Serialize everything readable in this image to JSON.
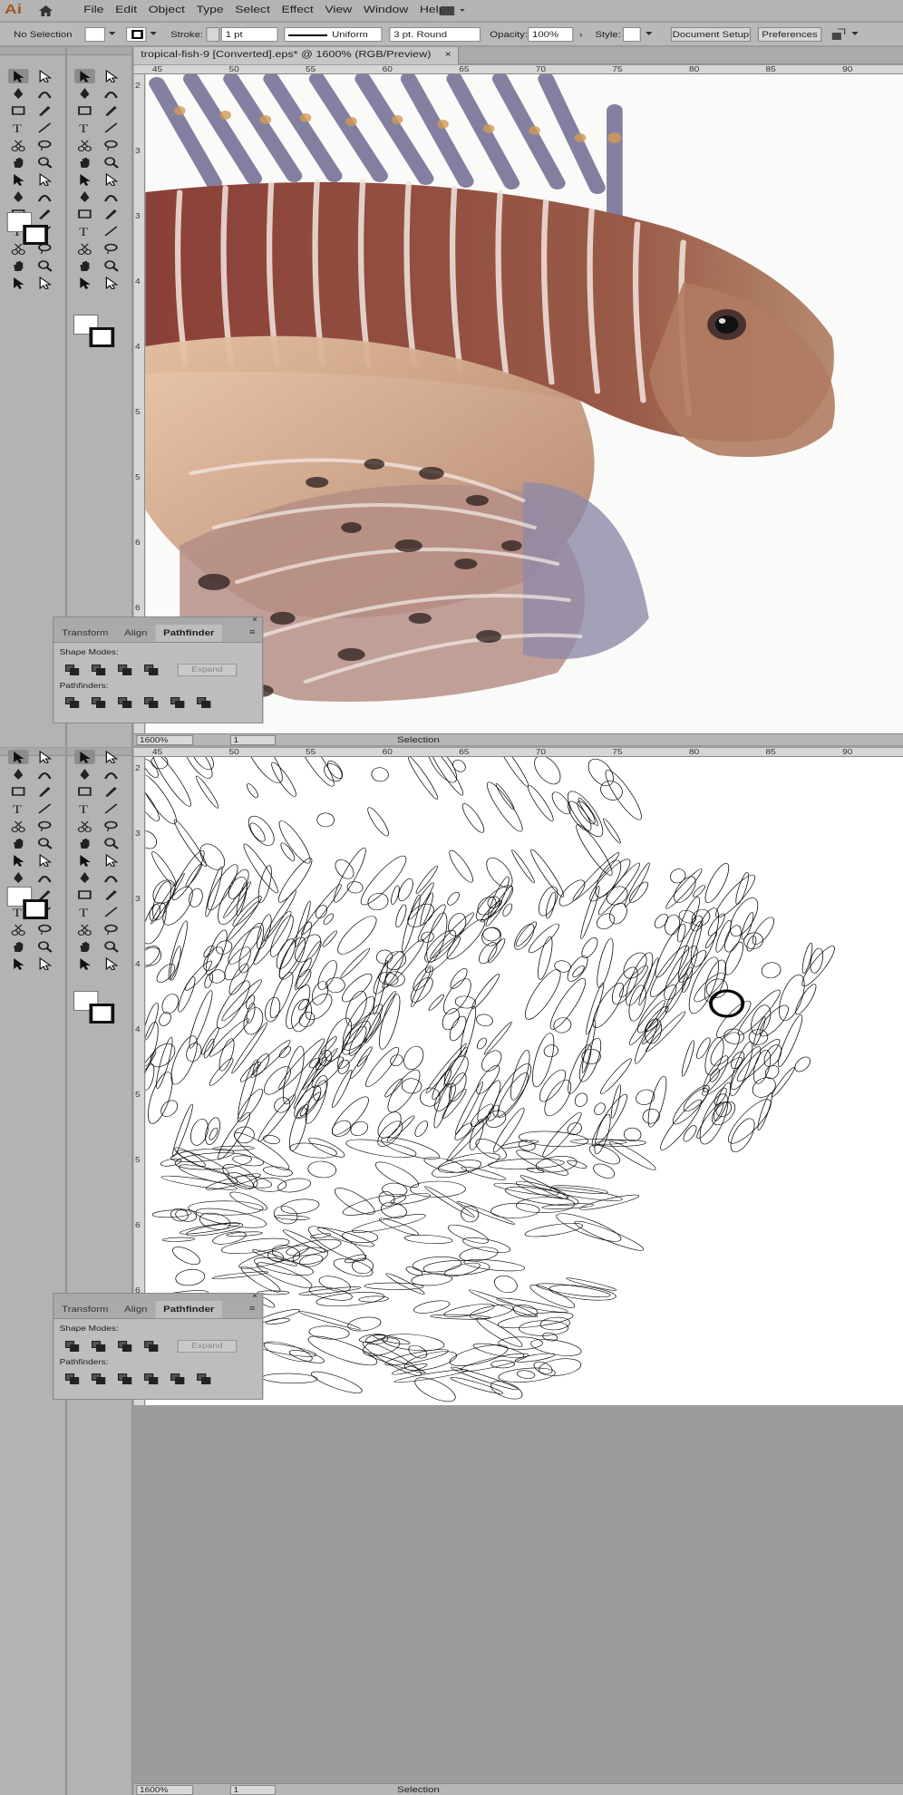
{
  "app": {
    "logo": "Ai"
  },
  "menu": [
    "File",
    "Edit",
    "Object",
    "Type",
    "Select",
    "Effect",
    "View",
    "Window",
    "Help"
  ],
  "control": {
    "selection": "No Selection",
    "stroke_label": "Stroke:",
    "stroke_value": "1 pt",
    "profile": "Uniform",
    "brush": "3 pt. Round",
    "opacity_label": "Opacity:",
    "opacity_value": "100%",
    "style_label": "Style:",
    "doc_setup": "Document Setup",
    "preferences": "Preferences"
  },
  "document": {
    "tab_title": "tropical-fish-9 [Converted].eps* @ 1600% (RGB/Preview)",
    "close": "×"
  },
  "ruler_h": [
    "45",
    "50",
    "55",
    "60",
    "65",
    "70",
    "75",
    "80",
    "85",
    "90"
  ],
  "ruler_v": [
    "2",
    "3",
    "3",
    "4",
    "4",
    "5",
    "5",
    "6",
    "6"
  ],
  "panel": {
    "tabs": [
      "Transform",
      "Align",
      "Pathfinder"
    ],
    "shape_modes": "Shape Modes:",
    "expand": "Expand",
    "pathfinders": "Pathfinders:"
  },
  "status": {
    "zoom": "1600%",
    "page": "1",
    "mode": "Selection"
  },
  "icons": [
    "selection-icon",
    "direct-selection-icon",
    "pen-icon",
    "curvature-icon",
    "rectangle-icon",
    "brush-icon",
    "type-icon",
    "line-icon",
    "scissors-icon",
    "lasso-icon",
    "hand-icon",
    "zoom-icon"
  ]
}
